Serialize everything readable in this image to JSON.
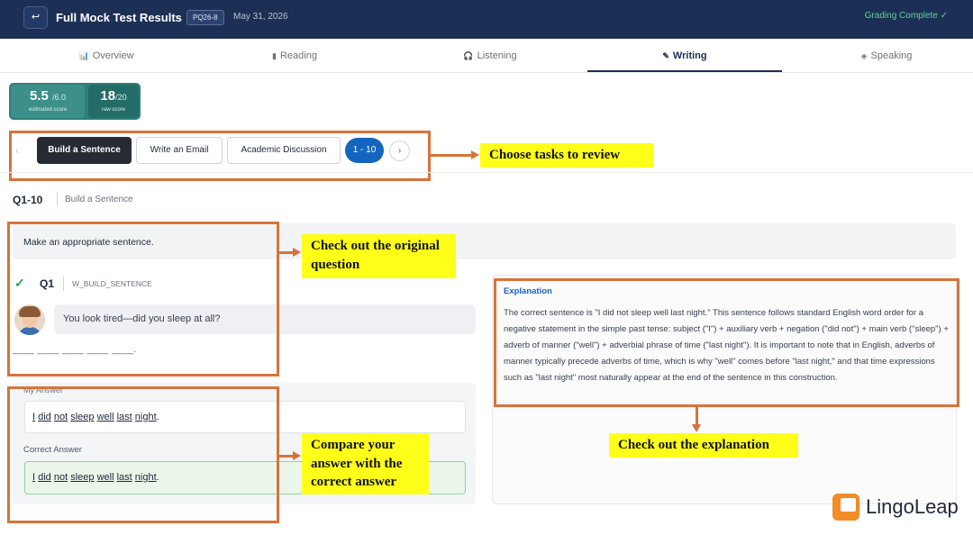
{
  "header": {
    "back_icon": "↩",
    "title": "Full Mock Test Results",
    "code": "PQ26-8",
    "date": "May 31, 2026",
    "status": "Grading Complete ✓",
    "bg_color": "#1c2f55"
  },
  "tabs": [
    {
      "icon": "📊",
      "label": "Overview"
    },
    {
      "icon": "▮",
      "label": "Reading"
    },
    {
      "icon": "🎧",
      "label": "Listening"
    },
    {
      "icon": "✎",
      "label": "Writing"
    },
    {
      "icon": "◈",
      "label": "Speaking"
    }
  ],
  "active_tab": "Writing",
  "score": {
    "estimated": "5.5",
    "estimated_max": "/6.0",
    "estimated_label": "estimated score",
    "raw": "18",
    "raw_max": "/20",
    "raw_label": "raw score"
  },
  "task_nav": {
    "prev": "‹",
    "tasks": [
      "Build a Sentence",
      "Write an Email",
      "Academic Discussion"
    ],
    "selected": "Build a Sentence",
    "range": "1 - 10",
    "next": "›"
  },
  "section": {
    "range": "Q1-10",
    "type": "Build a Sentence"
  },
  "prompt": "Make an appropriate sentence.",
  "question": {
    "status_icon": "✓",
    "number": "Q1",
    "code": "W_BUILD_SENTENCE",
    "dialogue": "You look tired—did you sleep at all?",
    "blanks": "____ ____ ____ ____ ____."
  },
  "answers": {
    "my_label": "My Answer",
    "my_words": [
      "I",
      "did",
      "not",
      "sleep",
      "well",
      "last",
      "night"
    ],
    "correct_label": "Correct Answer",
    "correct_words": [
      "I",
      "did",
      "not",
      "sleep",
      "well",
      "last",
      "night"
    ],
    "punct": "."
  },
  "explanation": {
    "title": "Explanation",
    "body": "The correct sentence is \"I did not sleep well last night.\" This sentence follows standard English word order for a negative statement in the simple past tense: subject (\"I\") + auxiliary verb + negation (\"did not\") + main verb (\"sleep\") + adverb of manner (\"well\") + adverbial phrase of time (\"last night\"). It is important to note that in English, adverbs of manner typically precede adverbs of time, which is why \"well\" comes before \"last night,\" and that time expressions such as \"last night\" most naturally appear at the end of the sentence in this construction."
  },
  "callouts": {
    "tasks": "Choose tasks to review",
    "question": "Check out the original question",
    "answer": "Compare your answer with the correct answer",
    "explanation": "Check out the explanation"
  },
  "logo": {
    "text": "LingoLeap",
    "color": "#f28c28"
  },
  "colors": {
    "highlight": "#d7733a",
    "callout_bg": "#ffff1a",
    "accent": "#1565c0",
    "success": "#22a052"
  }
}
